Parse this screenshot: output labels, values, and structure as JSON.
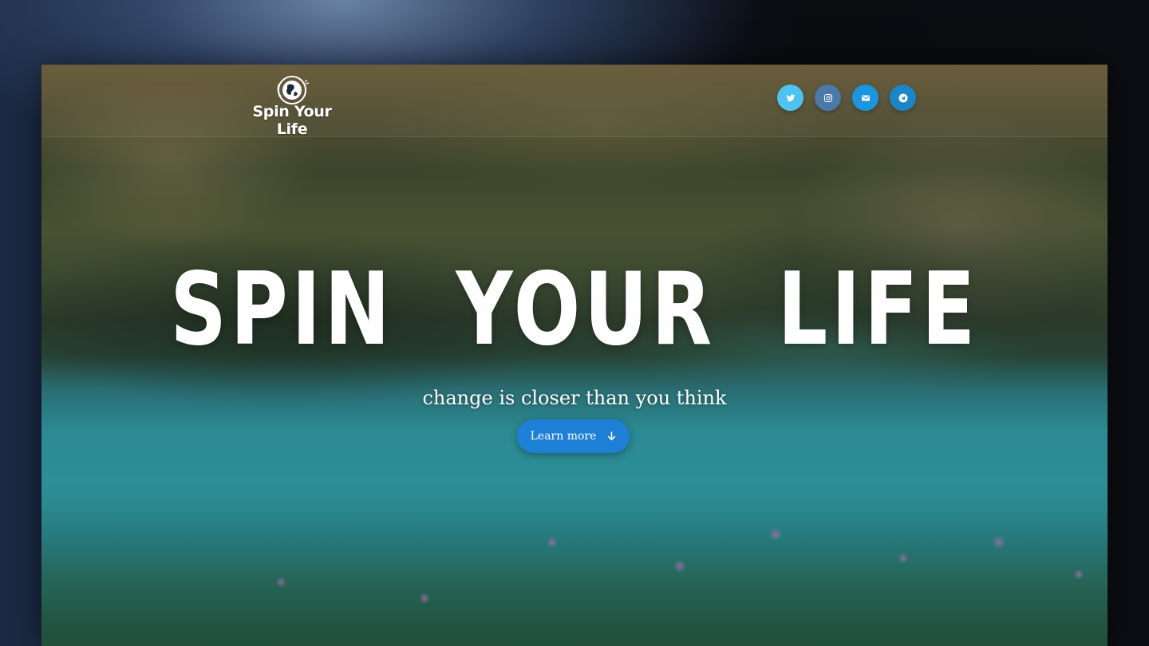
{
  "header": {
    "logo_text": "Spin Your Life",
    "globe_icon": "globe-icon",
    "socials": [
      {
        "name": "twitter",
        "icon": "twitter-icon",
        "color": "#4cc3f0"
      },
      {
        "name": "instagram",
        "icon": "instagram-icon",
        "color": "#4a79ab"
      },
      {
        "name": "email",
        "icon": "envelope-icon",
        "color": "#1c95e0"
      },
      {
        "name": "telegram",
        "icon": "telegram-icon",
        "color": "#1a86c8"
      }
    ]
  },
  "hero": {
    "title": "SPIN  YOUR  LIFE",
    "subtitle": "change is closer than you think",
    "cta_label": "Learn more",
    "cta_icon": "arrow-down-icon"
  },
  "colors": {
    "accent": "#1d7fd6"
  }
}
